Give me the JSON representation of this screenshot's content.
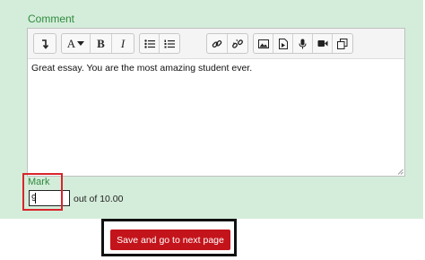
{
  "comment": {
    "label": "Comment",
    "text": "Great essay. You are the most amazing student ever."
  },
  "toolbar": {
    "buttons": [
      {
        "icon": "expand-toolbar-icon"
      },
      {
        "icon": "font-size-icon",
        "label": "A"
      },
      {
        "icon": "bold-icon",
        "label": "B"
      },
      {
        "icon": "italic-icon",
        "label": "I"
      },
      {
        "icon": "unordered-list-icon"
      },
      {
        "icon": "ordered-list-icon"
      },
      {
        "icon": "link-icon"
      },
      {
        "icon": "unlink-icon"
      },
      {
        "icon": "image-icon"
      },
      {
        "icon": "media-icon"
      },
      {
        "icon": "record-audio-icon"
      },
      {
        "icon": "record-video-icon"
      },
      {
        "icon": "manage-files-icon"
      }
    ]
  },
  "mark": {
    "label": "Mark",
    "value": "9",
    "out_of": "out of 10.00"
  },
  "actions": {
    "save_label": "Save and go to next page"
  },
  "colors": {
    "panel_bg": "#d4edda",
    "label_green": "#2f8a3e",
    "highlight_red": "#d8252c",
    "button_red": "#c4141b",
    "frame_black": "#111111"
  }
}
